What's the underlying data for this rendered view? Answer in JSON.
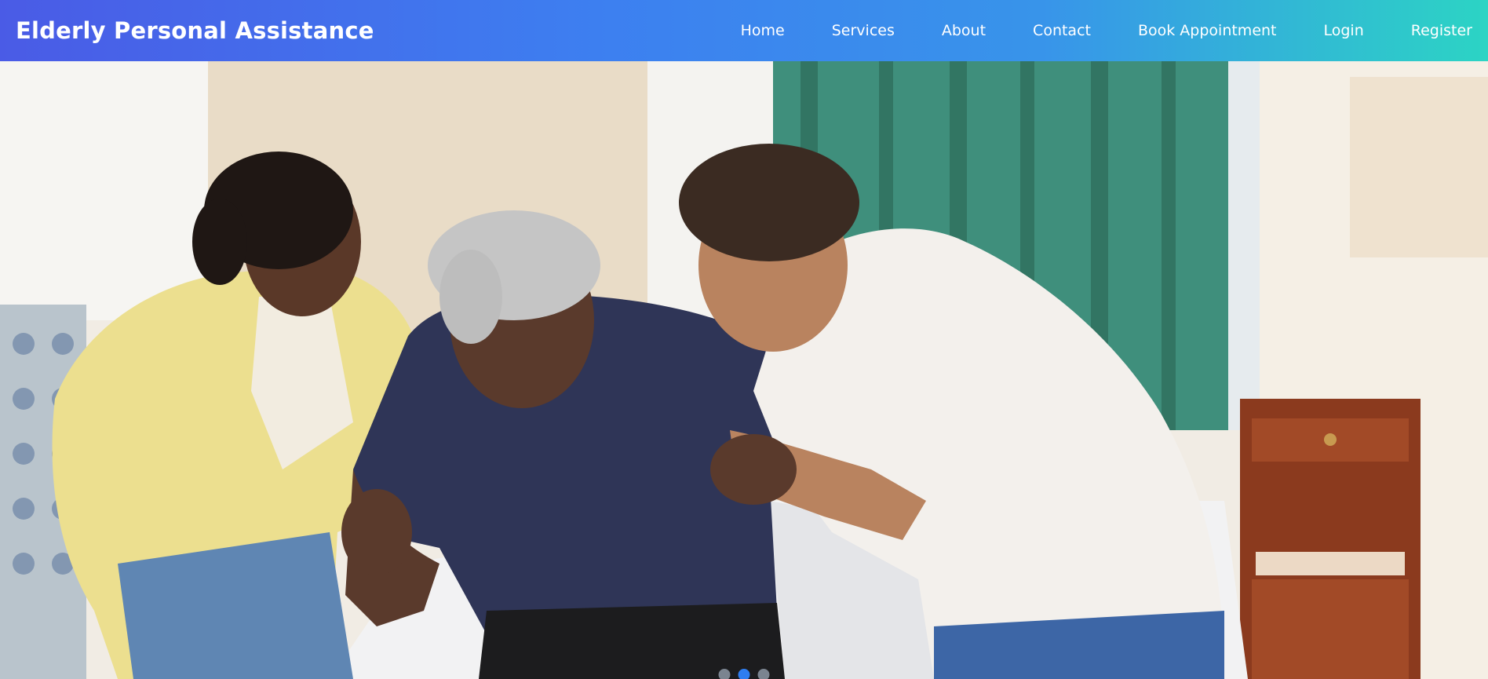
{
  "brand": {
    "title": "Elderly Personal Assistance"
  },
  "nav": {
    "items": [
      {
        "label": "Home"
      },
      {
        "label": "Services"
      },
      {
        "label": "About"
      },
      {
        "label": "Contact"
      },
      {
        "label": "Book Appointment"
      },
      {
        "label": "Login"
      },
      {
        "label": "Register"
      }
    ]
  },
  "carousel": {
    "slide_count": 3,
    "active_index": 1
  },
  "colors": {
    "nav_gradient_start": "#4a5be6",
    "nav_gradient_end": "#2cd4c4",
    "active_indicator": "#2f7df0"
  }
}
